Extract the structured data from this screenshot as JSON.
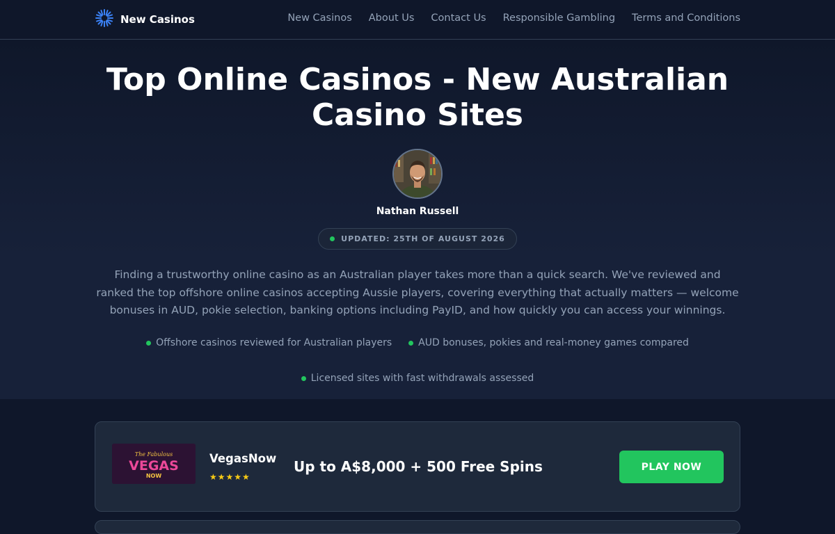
{
  "header": {
    "brand_name": "New Casinos",
    "brand_icon": "sunburst-logo-icon",
    "nav": [
      {
        "label": "New Casinos"
      },
      {
        "label": "About Us"
      },
      {
        "label": "Contact Us"
      },
      {
        "label": "Responsible Gambling"
      },
      {
        "label": "Terms and Conditions"
      }
    ]
  },
  "hero": {
    "title_line1": "Top Online Casinos - New Australian",
    "title_line2": "Casino Sites",
    "author": "Nathan Russell",
    "updated": "UPDATED: 25TH OF AUGUST 2026",
    "intro": "Finding a trustworthy online casino as an Australian player takes more than a quick search. We've reviewed and ranked the top offshore online casinos accepting Aussie players, covering everything that actually matters — welcome bonuses in AUD, pokie selection, banking options including PayID, and how quickly you can access your winnings.",
    "points": [
      "Offshore casinos reviewed for Australian players",
      "AUD bonuses, pokies and real-money games compared",
      "Licensed sites with fast withdrawals assessed"
    ]
  },
  "listing": {
    "casinos": [
      {
        "name": "VegasNow",
        "logo_script": "The Fabulous",
        "logo_main": "VEGAS",
        "logo_sub": "NOW",
        "rating": 5,
        "stars": "★★★★★",
        "bonus": "Up to A$8,000 + 500 Free Spins",
        "cta": "PLAY NOW"
      }
    ]
  },
  "colors": {
    "background": "#0f172a",
    "card": "#1e293b",
    "accent_green": "#22c55e",
    "accent_blue": "#3b82f6",
    "star": "#facc15",
    "muted_text": "#94a3b8"
  }
}
